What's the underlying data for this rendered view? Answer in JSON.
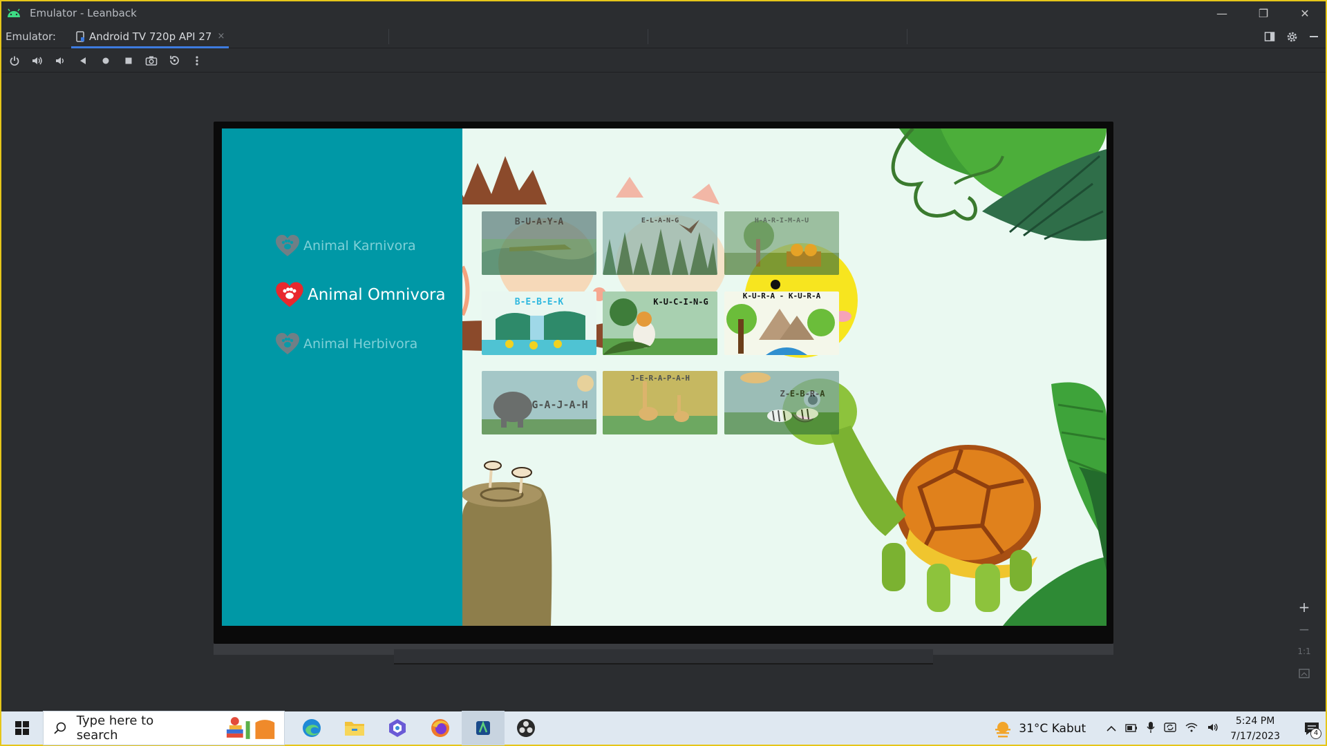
{
  "window": {
    "title": "Emulator - Leanback",
    "controls": {
      "minimize": "—",
      "restore": "❐",
      "close": "✕"
    }
  },
  "tabbar": {
    "label": "Emulator:",
    "tab": "Android TV 720p API 27",
    "tab_close": "×"
  },
  "app": {
    "menu": [
      {
        "label": "Animal Karnivora",
        "active": false
      },
      {
        "label": "Animal Omnivora",
        "active": true
      },
      {
        "label": "Animal Herbivora",
        "active": false
      }
    ],
    "cards": [
      {
        "name": "B-U-A-Y-A"
      },
      {
        "name": "E-L-A-N-G"
      },
      {
        "name": "H-A-R-I-M-A-U"
      },
      {
        "name": "B-E-B-E-K"
      },
      {
        "name": "K-U-C-I-N-G"
      },
      {
        "name": "K-U-R-A - K-U-R-A"
      },
      {
        "name": "G-A-J-A-H"
      },
      {
        "name": "J-E-R-A-P-A-H"
      },
      {
        "name": "Z-E-B-R-A"
      }
    ]
  },
  "zoom": {
    "plus": "+",
    "minus": "−",
    "one_to_one": "1:1"
  },
  "taskbar": {
    "search_placeholder": "Type here to search",
    "weather": "31°C  Kabut",
    "time": "5:24 PM",
    "date": "7/17/2023",
    "notification_count": "4"
  }
}
